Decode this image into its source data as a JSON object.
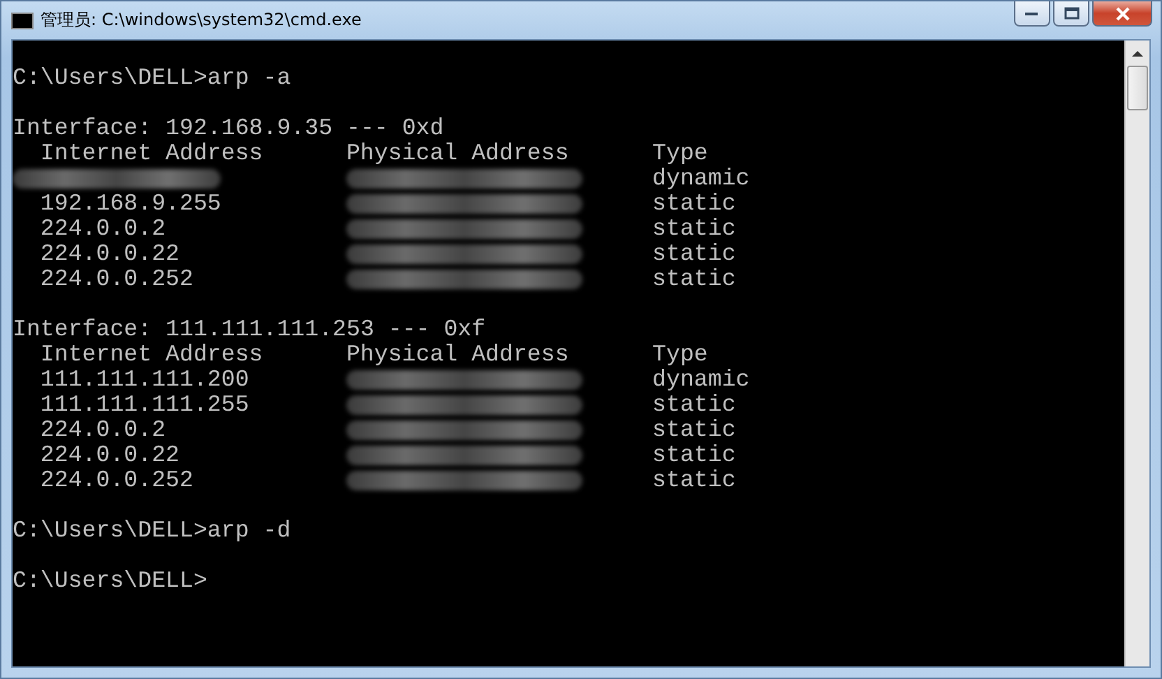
{
  "window": {
    "title": "管理员: C:\\windows\\system32\\cmd.exe"
  },
  "console": [
    {
      "kind": "blank"
    },
    {
      "kind": "prompt",
      "text": "C:\\Users\\DELL>arp -a"
    },
    {
      "kind": "blank"
    },
    {
      "kind": "interface",
      "text": "Interface: 192.168.9.35 --- 0xd"
    },
    {
      "kind": "header",
      "columns": [
        "Internet Address",
        "Physical Address",
        "Type"
      ]
    },
    {
      "kind": "entry",
      "address_hidden": true,
      "type": "dynamic"
    },
    {
      "kind": "entry",
      "address_hidden": false,
      "address": "192.168.9.255",
      "type": "static"
    },
    {
      "kind": "entry",
      "address_hidden": false,
      "address": "224.0.0.2",
      "type": "static"
    },
    {
      "kind": "entry",
      "address_hidden": false,
      "address": "224.0.0.22",
      "type": "static"
    },
    {
      "kind": "entry",
      "address_hidden": false,
      "address": "224.0.0.252",
      "type": "static"
    },
    {
      "kind": "blank"
    },
    {
      "kind": "interface",
      "text": "Interface: 111.111.111.253 --- 0xf"
    },
    {
      "kind": "header",
      "columns": [
        "Internet Address",
        "Physical Address",
        "Type"
      ]
    },
    {
      "kind": "entry",
      "address_hidden": false,
      "address": "111.111.111.200",
      "type": "dynamic"
    },
    {
      "kind": "entry",
      "address_hidden": false,
      "address": "111.111.111.255",
      "type": "static"
    },
    {
      "kind": "entry",
      "address_hidden": false,
      "address": "224.0.0.2",
      "type": "static"
    },
    {
      "kind": "entry",
      "address_hidden": false,
      "address": "224.0.0.22",
      "type": "static"
    },
    {
      "kind": "entry",
      "address_hidden": false,
      "address": "224.0.0.252",
      "type": "static"
    },
    {
      "kind": "blank"
    },
    {
      "kind": "prompt",
      "text": "C:\\Users\\DELL>arp -d"
    },
    {
      "kind": "blank"
    },
    {
      "kind": "prompt",
      "text": "C:\\Users\\DELL>"
    }
  ]
}
